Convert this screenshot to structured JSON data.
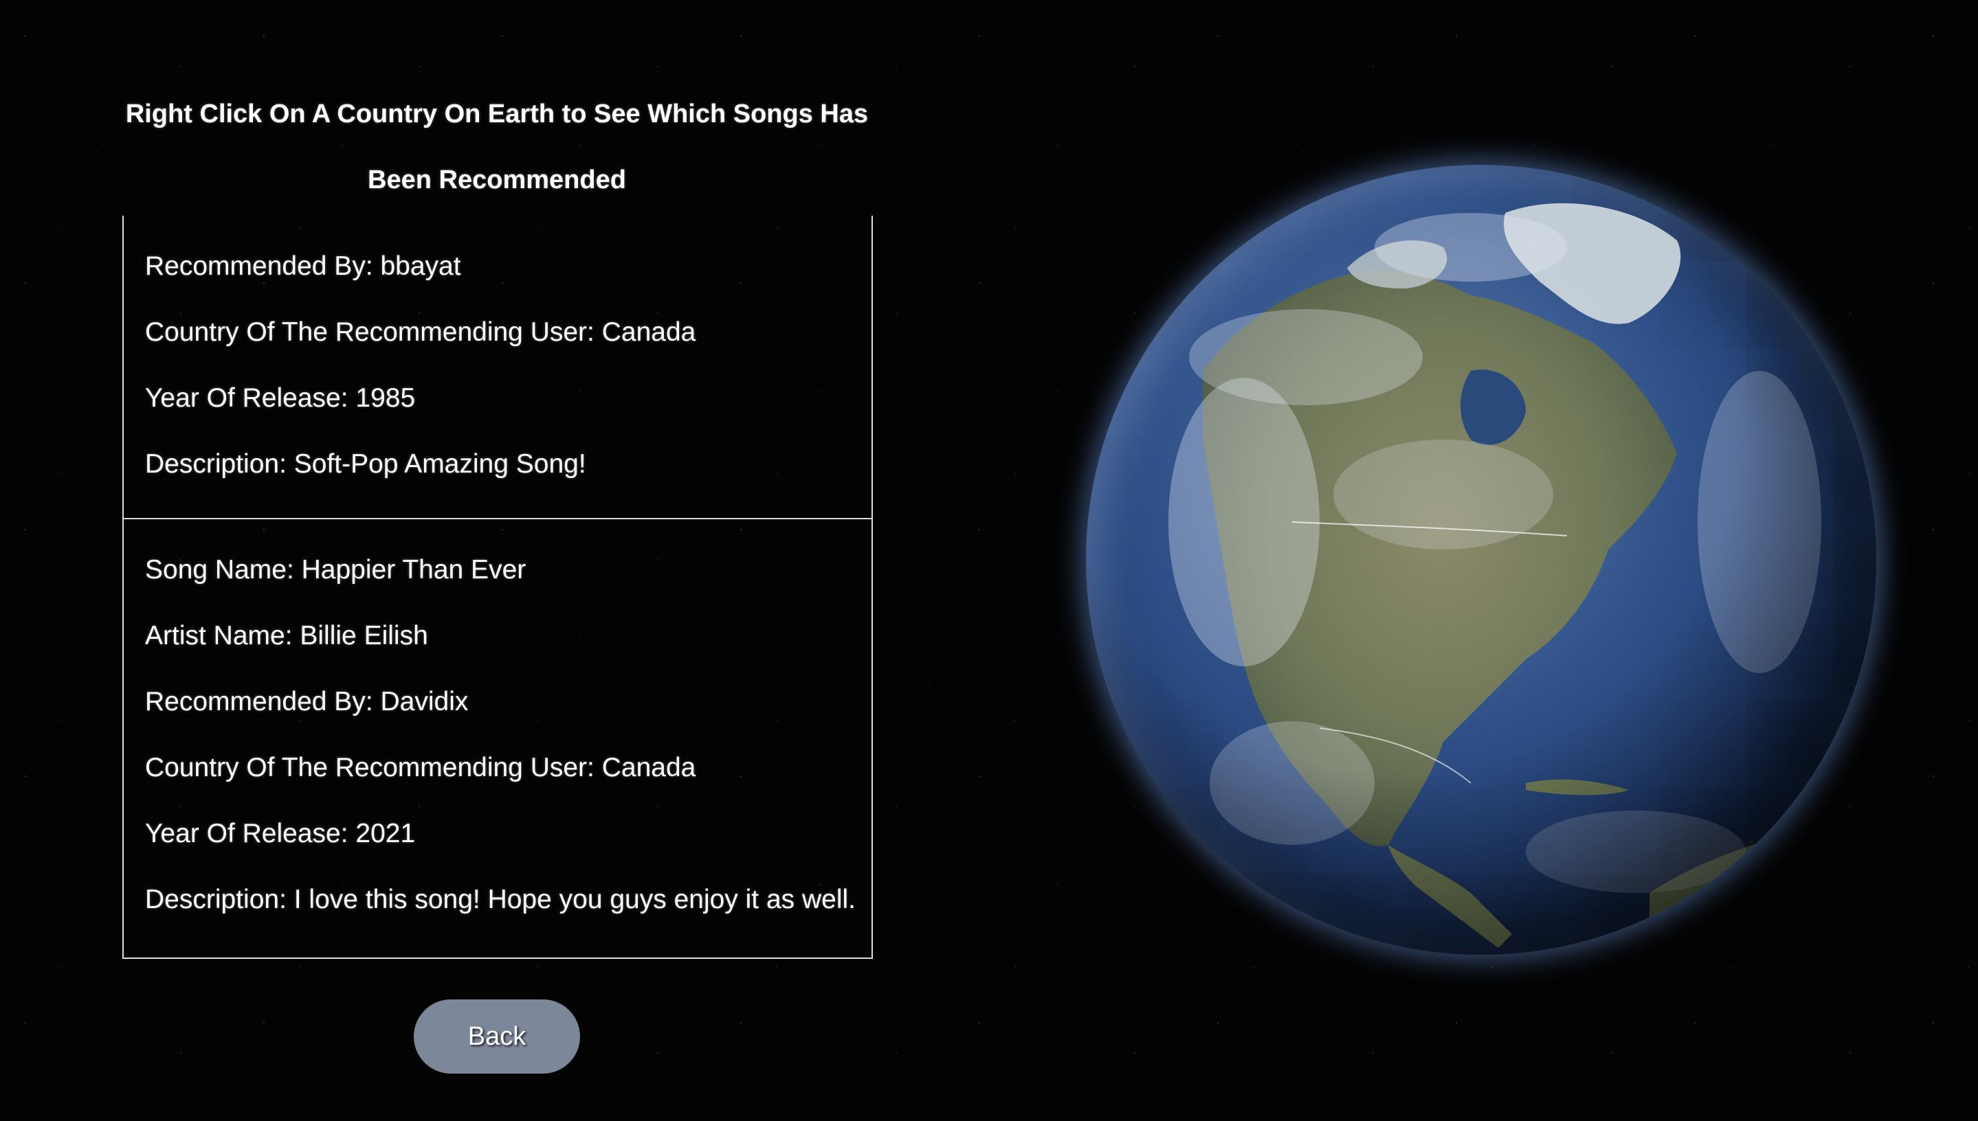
{
  "header": {
    "title_line1": "Right Click On A Country On Earth to See Which Songs Has",
    "title_line2": "Been Recommended"
  },
  "songs": [
    {
      "recommended_by": "Recommended By: bbayat",
      "country": "Country Of The Recommending User: Canada",
      "year": "Year Of Release: 1985",
      "description": "Description: Soft-Pop Amazing Song!"
    },
    {
      "song_name": "Song Name: Happier Than Ever",
      "artist_name": "Artist Name: Billie Eilish",
      "recommended_by": "Recommended By: Davidix",
      "country": "Country Of The Recommending User: Canada",
      "year": "Year Of Release: 2021",
      "description": "Description: I love this song! Hope you guys enjoy it as well."
    }
  ],
  "back_button": {
    "label": "Back"
  },
  "colors": {
    "background": "#000000",
    "button": "#7c8799",
    "border": "#dddddd",
    "ocean": "#2f5088",
    "land": "#7d8264"
  },
  "icons": {
    "globe": "earth-globe"
  }
}
